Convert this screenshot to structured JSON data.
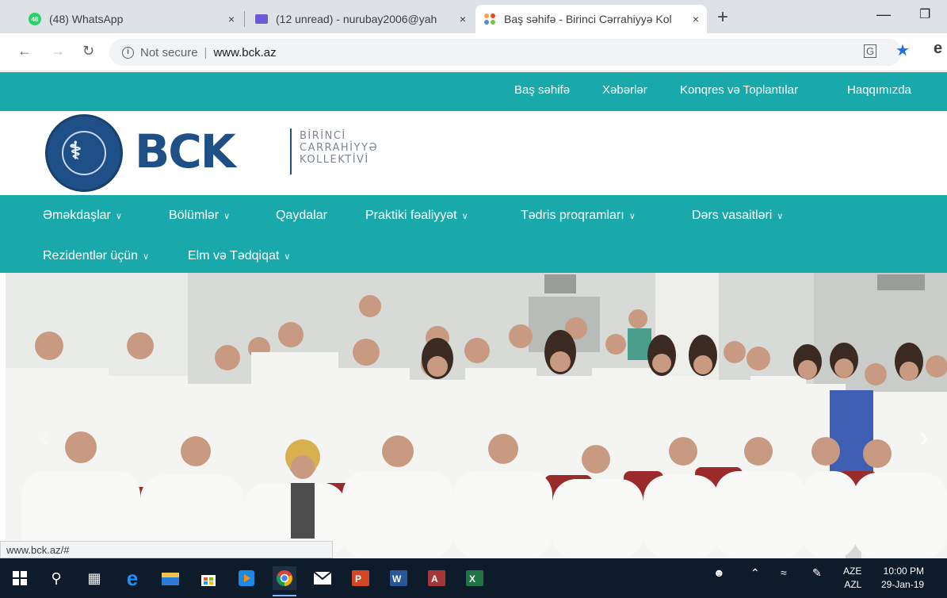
{
  "browser": {
    "tabs": [
      {
        "title": "(48) WhatsApp",
        "badge": "48"
      },
      {
        "title": "(12 unread) - nurubay2006@yah"
      },
      {
        "title": "Baş səhifə - Birinci Cərrahiyyə Kol"
      }
    ],
    "new_tab": "+",
    "close_glyph": "×",
    "security_label": "Not secure",
    "url": "www.bck.az",
    "status_url": "www.bck.az/#"
  },
  "site": {
    "top_nav": [
      "Baş səhifə",
      "Xəbərlər",
      "Konqres və Toplantılar",
      "Haqqımızda"
    ],
    "logo": {
      "mark": "BCK",
      "subtitle": [
        "BİRİNCİ",
        "CARRAHİYYƏ",
        "KOLLEKTİVİ"
      ]
    },
    "main_nav": [
      {
        "label": "Əməkdaşlar",
        "dropdown": true
      },
      {
        "label": "Bölümlər",
        "dropdown": true
      },
      {
        "label": "Qaydalar",
        "dropdown": false
      },
      {
        "label": "Praktiki fəaliyyət",
        "dropdown": true
      },
      {
        "label": "Tədris proqramları",
        "dropdown": true
      },
      {
        "label": "Dərs vasaitləri",
        "dropdown": true
      },
      {
        "label": "Rezidentlər üçün",
        "dropdown": true
      },
      {
        "label": "Elm və Tədqiqat",
        "dropdown": true
      }
    ],
    "accent_color": "#1aa9ab",
    "brand_color": "#1f4f87"
  },
  "taskbar": {
    "lang_top": "AZE",
    "lang_bottom": "AZL",
    "time": "10:00 PM",
    "date": "29-Jan-19"
  }
}
